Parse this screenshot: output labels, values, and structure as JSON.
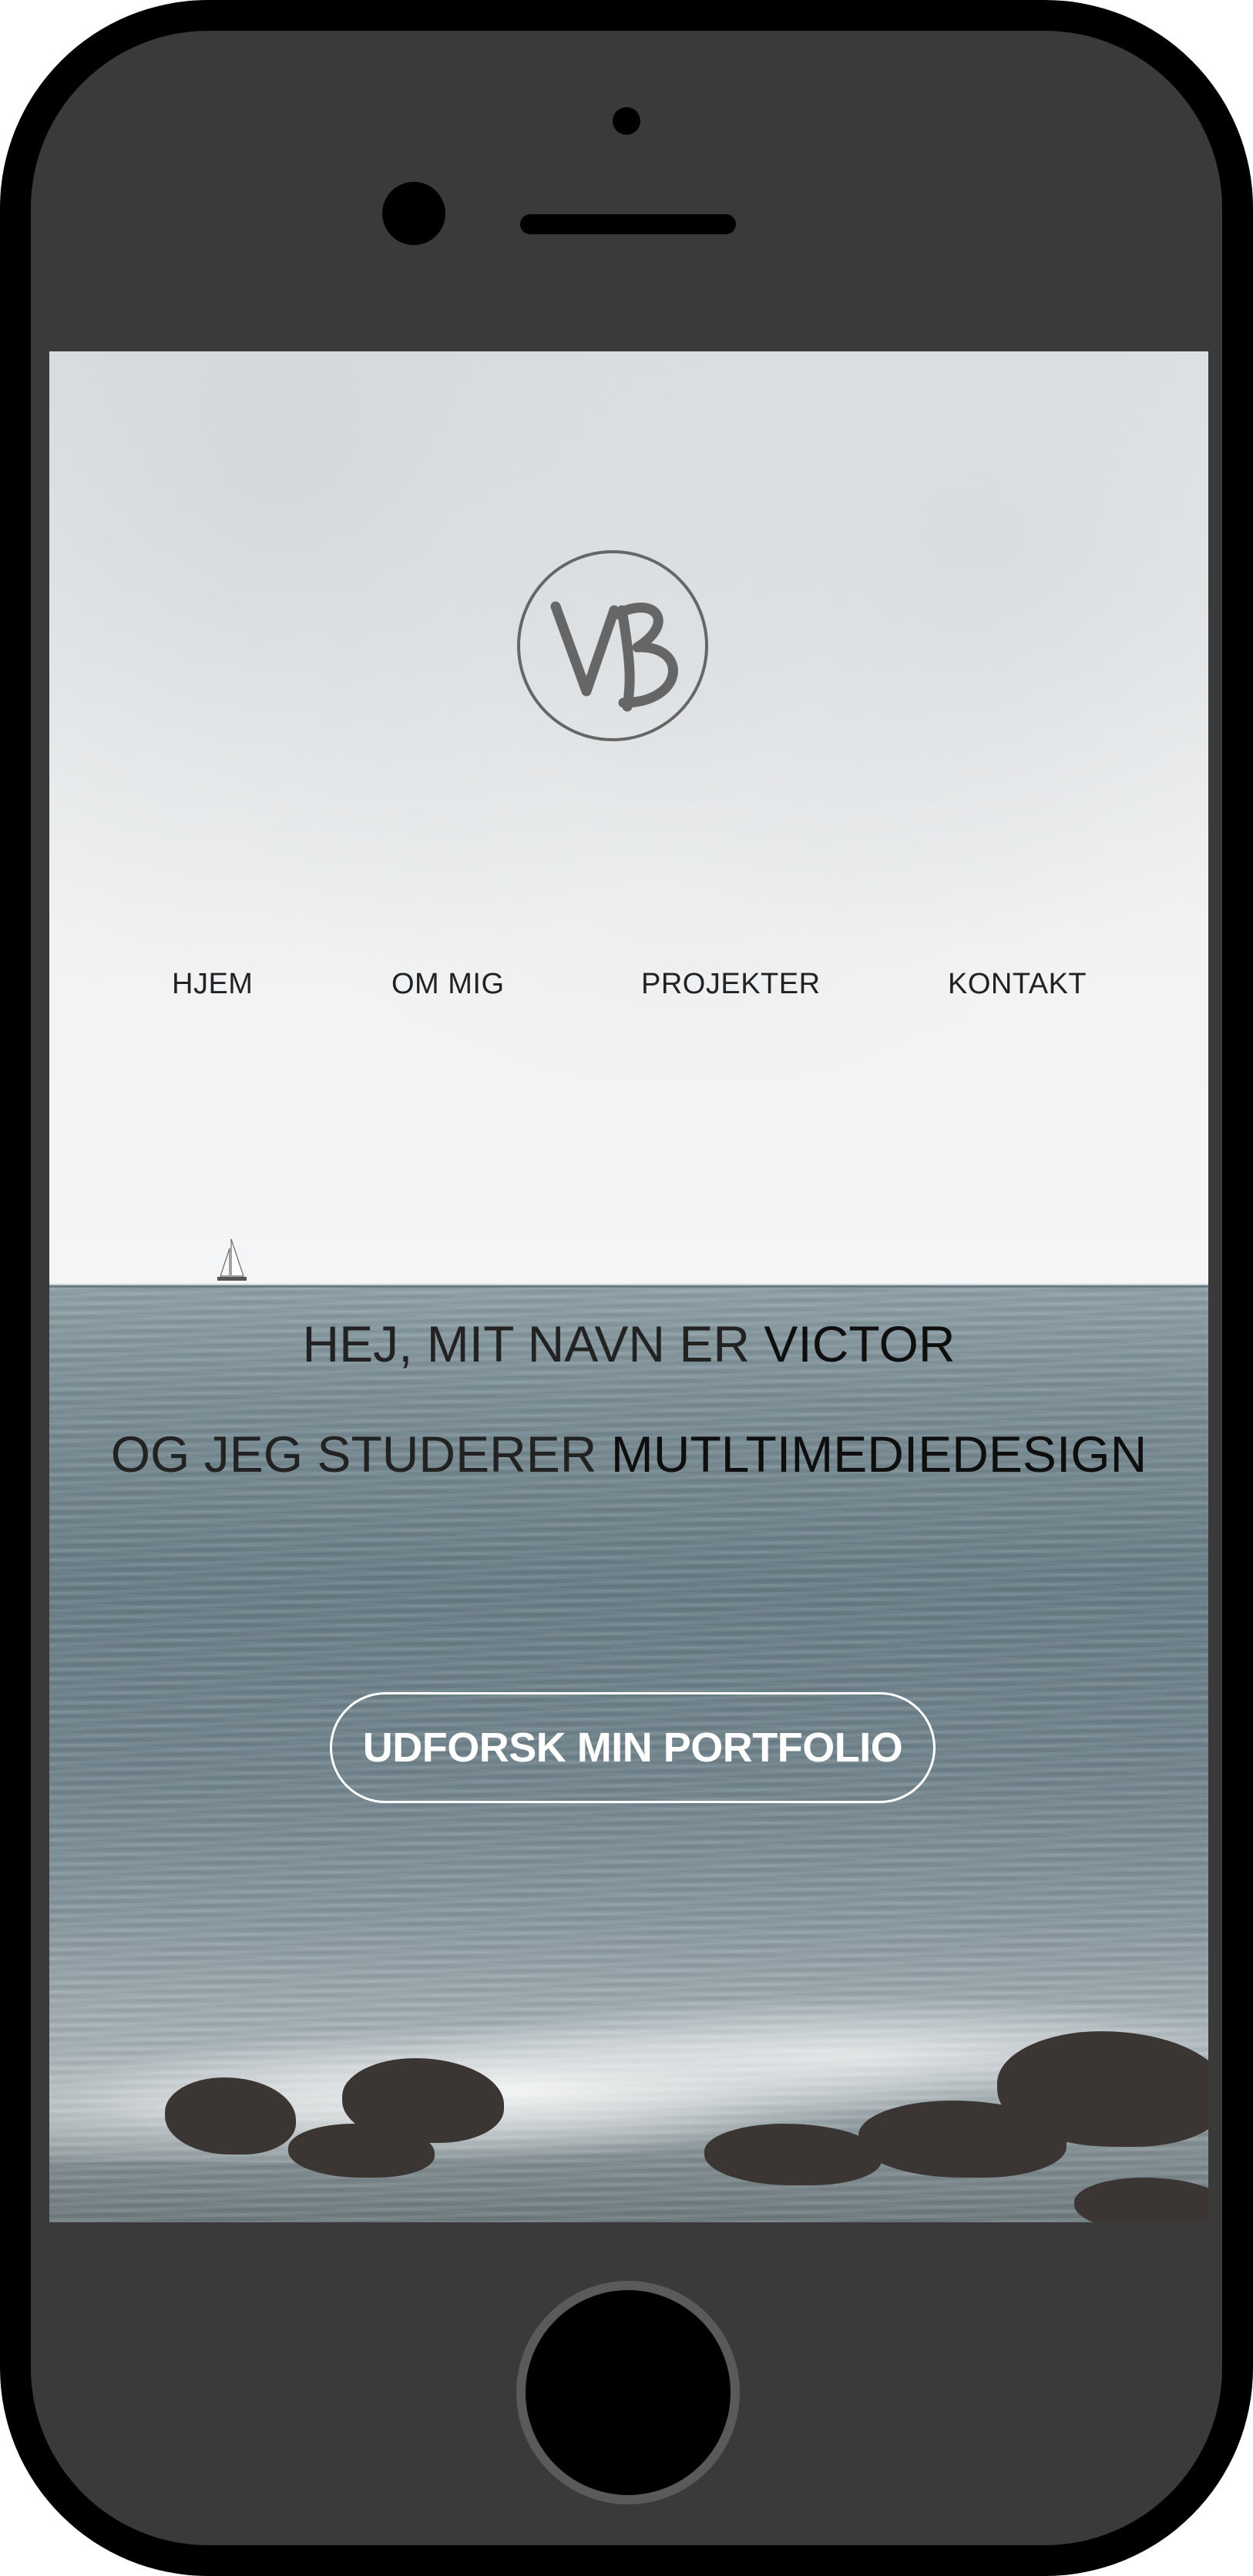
{
  "logo": {
    "text": "VB"
  },
  "nav": {
    "items": [
      {
        "label": "HJEM"
      },
      {
        "label": "OM MIG"
      },
      {
        "label": "PROJEKTER"
      },
      {
        "label": "KONTAKT"
      }
    ]
  },
  "hero": {
    "line1_prefix": "HEJ, MIT NAVN ER ",
    "line1_name": "VICTOR",
    "line2_prefix": "OG JEG STUDERER ",
    "line2_subject": "MUTLTIMEDIEDESIGN"
  },
  "cta": {
    "label": "UDFORSK MIN PORTFOLIO"
  },
  "colors": {
    "phone_frame": "#000000",
    "phone_body": "#3a3a3a",
    "sky": "#eef0f1",
    "sea": "#7c8f97",
    "text_dark": "#1a1a1a",
    "cta_text": "#ffffff"
  },
  "icons": [
    "camera-icon",
    "speaker-icon",
    "home-button-icon",
    "vb-logo-icon",
    "sailboat-icon"
  ]
}
